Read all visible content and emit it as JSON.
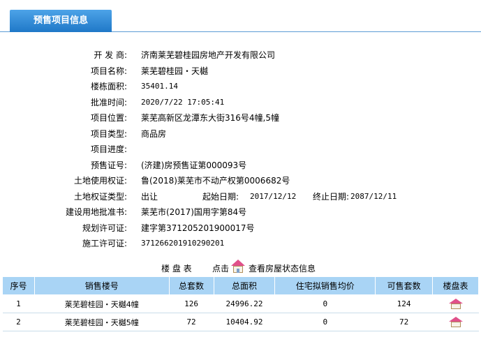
{
  "tab": {
    "title": "预售项目信息"
  },
  "info": {
    "developer": {
      "label": "开 发 商:",
      "value": "济南莱芜碧桂园房地产开发有限公司"
    },
    "project_name": {
      "label": "项目名称:",
      "value": "莱芜碧桂园・天樾"
    },
    "building_area": {
      "label": "楼栋面积:",
      "value": "35401.14"
    },
    "approval_time": {
      "label": "批准时间:",
      "value": "2020/7/22 17:05:41"
    },
    "location": {
      "label": "项目位置:",
      "value": "莱芜高新区龙潭东大街316号4幢,5幢"
    },
    "project_type": {
      "label": "项目类型:",
      "value": "商品房"
    },
    "progress": {
      "label": "项目进度:",
      "value": ""
    },
    "presale_cert": {
      "label": "预售证号:",
      "value": "(济建)房预售证第000093号"
    },
    "land_right_cert": {
      "label": "土地使用权证:",
      "value": "鲁(2018)莱芜市不动产权第0006682号"
    },
    "land_right_type": {
      "label": "土地权证类型:",
      "value": "出让"
    },
    "start_date": {
      "label": "起始日期:",
      "value": "2017/12/12"
    },
    "end_date": {
      "label": "终止日期:",
      "value": "2087/12/11"
    },
    "land_approval": {
      "label": "建设用地批准书:",
      "value": "莱芜市(2017)国用字第84号"
    },
    "planning_permit": {
      "label": "规划许可证:",
      "value": "建字第371205201900017号"
    },
    "construction_permit": {
      "label": "施工许可证:",
      "value": "371266201910290201"
    }
  },
  "legend": {
    "title": "楼 盘 表",
    "click": "点击",
    "view": "查看房屋状态信息",
    "icon": "house-icon"
  },
  "table": {
    "headers": [
      "序号",
      "销售楼号",
      "总套数",
      "总面积",
      "住宅拟销售均价",
      "可售套数",
      "楼盘表"
    ],
    "rows": [
      {
        "no": "1",
        "building": "莱芜碧桂园・天樾4幢",
        "total_units": "126",
        "total_area": "24996.22",
        "avg_price": "0",
        "available": "124"
      },
      {
        "no": "2",
        "building": "莱芜碧桂园・天樾5幢",
        "total_units": "72",
        "total_area": "10404.92",
        "avg_price": "0",
        "available": "72"
      }
    ]
  },
  "colors": {
    "tab": "#1f78c8",
    "header": "#a9d4f5",
    "roof": "#e0508a"
  }
}
